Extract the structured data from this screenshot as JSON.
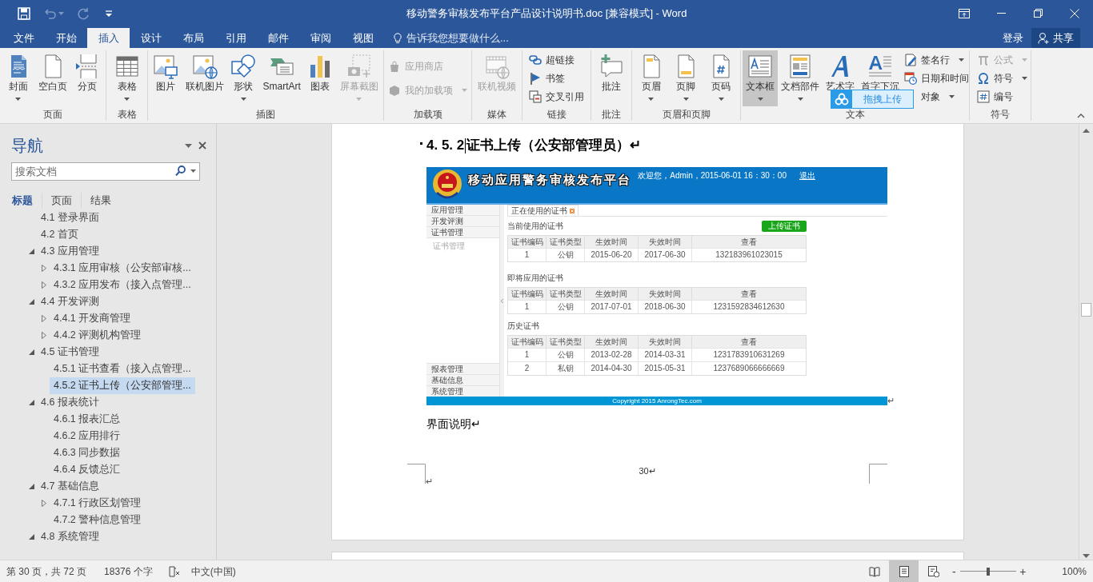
{
  "title_bar": {
    "quick_access": [
      {
        "kind": "save",
        "disabled": false
      },
      {
        "kind": "undo",
        "disabled": true
      },
      {
        "kind": "redo",
        "disabled": true
      },
      {
        "kind": "customize",
        "disabled": false
      }
    ],
    "title": "移动警务审核发布平台产品设计说明书.doc [兼容模式] - Word"
  },
  "ribbon_tabs": [
    {
      "label": "文件",
      "selected": false
    },
    {
      "label": "开始",
      "selected": false
    },
    {
      "label": "插入",
      "selected": true
    },
    {
      "label": "设计",
      "selected": false
    },
    {
      "label": "布局",
      "selected": false
    },
    {
      "label": "引用",
      "selected": false
    },
    {
      "label": "邮件",
      "selected": false
    },
    {
      "label": "审阅",
      "selected": false
    },
    {
      "label": "视图",
      "selected": false
    }
  ],
  "tell_me": "告诉我您想要做什么...",
  "account": {
    "sign_in": "登录",
    "share": "共享"
  },
  "ribbon_groups": [
    {
      "label": "页面",
      "items": [
        {
          "label": "封面",
          "kind": "large",
          "dropdown": true,
          "disabled": false,
          "highlighted": false
        },
        {
          "label": "空白页",
          "kind": "large",
          "dropdown": false,
          "disabled": false,
          "highlighted": false
        },
        {
          "label": "分页",
          "kind": "large",
          "dropdown": false,
          "disabled": false,
          "highlighted": false
        }
      ]
    },
    {
      "label": "表格",
      "items": [
        {
          "label": "表格",
          "kind": "large",
          "dropdown": true,
          "disabled": false,
          "highlighted": false
        }
      ]
    },
    {
      "label": "插图",
      "items": [
        {
          "label": "图片",
          "kind": "large",
          "dropdown": false,
          "disabled": false,
          "highlighted": false
        },
        {
          "label": "联机图片",
          "kind": "large",
          "dropdown": false,
          "disabled": false,
          "highlighted": false
        },
        {
          "label": "形状",
          "kind": "large",
          "dropdown": true,
          "disabled": false,
          "highlighted": false
        },
        {
          "label": "SmartArt",
          "kind": "large",
          "dropdown": false,
          "disabled": false,
          "highlighted": false
        },
        {
          "label": "图表",
          "kind": "large",
          "dropdown": false,
          "disabled": false,
          "highlighted": false
        },
        {
          "label": "屏幕截图",
          "kind": "large",
          "dropdown": true,
          "disabled": true,
          "highlighted": false
        }
      ]
    },
    {
      "label": "加载项",
      "items": [
        {
          "label": "应用商店",
          "kind": "small",
          "dropdown": false,
          "disabled": true,
          "highlighted": false
        },
        {
          "label": "我的加载项",
          "kind": "small",
          "dropdown": true,
          "disabled": true,
          "highlighted": false
        }
      ]
    },
    {
      "label": "媒体",
      "items": [
        {
          "label": "联机视频",
          "kind": "large",
          "dropdown": false,
          "disabled": true,
          "highlighted": false
        }
      ]
    },
    {
      "label": "链接",
      "items": [
        {
          "label": "超链接",
          "kind": "small",
          "dropdown": false,
          "disabled": false,
          "highlighted": false
        },
        {
          "label": "书签",
          "kind": "small",
          "dropdown": false,
          "disabled": false,
          "highlighted": false
        },
        {
          "label": "交叉引用",
          "kind": "small",
          "dropdown": false,
          "disabled": false,
          "highlighted": false
        }
      ]
    },
    {
      "label": "批注",
      "items": [
        {
          "label": "批注",
          "kind": "large",
          "dropdown": false,
          "disabled": false,
          "highlighted": false
        }
      ]
    },
    {
      "label": "页眉和页脚",
      "items": [
        {
          "label": "页眉",
          "kind": "large",
          "dropdown": true,
          "disabled": false,
          "highlighted": false
        },
        {
          "label": "页脚",
          "kind": "large",
          "dropdown": true,
          "disabled": false,
          "highlighted": false
        },
        {
          "label": "页码",
          "kind": "large",
          "dropdown": true,
          "disabled": false,
          "highlighted": false
        }
      ]
    },
    {
      "label": "文本",
      "items": [
        {
          "label": "文本框",
          "kind": "large",
          "dropdown": true,
          "disabled": false,
          "highlighted": true
        },
        {
          "label": "文档部件",
          "kind": "large",
          "dropdown": true,
          "disabled": false,
          "highlighted": false
        },
        {
          "label": "艺术字",
          "kind": "large",
          "disabled": false,
          "highlighted": false
        },
        {
          "label": "首字下沉",
          "kind": "large",
          "disabled": false,
          "highlighted": false
        },
        {
          "label": "签名行",
          "kind": "small",
          "dropdown": true,
          "disabled": false,
          "highlighted": false
        },
        {
          "label": "日期和时间",
          "kind": "small",
          "dropdown": false,
          "disabled": false,
          "highlighted": false
        },
        {
          "label": "对象",
          "kind": "small",
          "dropdown": true,
          "disabled": false,
          "highlighted": false
        }
      ]
    },
    {
      "label": "符号",
      "items": [
        {
          "label": "公式",
          "kind": "small",
          "dropdown": true,
          "disabled": true,
          "highlighted": false
        },
        {
          "label": "符号",
          "kind": "small",
          "dropdown": true,
          "disabled": false,
          "highlighted": false
        },
        {
          "label": "编号",
          "kind": "small",
          "dropdown": false,
          "disabled": false,
          "highlighted": false
        }
      ]
    }
  ],
  "upload_overlay": {
    "label": "拖拽上传"
  },
  "navigation": {
    "title": "导航",
    "search": {
      "placeholder": "搜索文档"
    },
    "tabs": [
      {
        "label": "标题",
        "selected": true
      },
      {
        "label": "页面",
        "selected": false
      },
      {
        "label": "结果",
        "selected": false
      }
    ],
    "tree": [
      {
        "label": "4.1 登录界面",
        "selected": false
      },
      {
        "label": "4.2 首页",
        "selected": false
      },
      {
        "label": "4.3 应用管理",
        "selected": false,
        "expanded": true,
        "children": [
          {
            "label": "4.3.1 应用审核（公安部审核...",
            "selected": false,
            "expanded": false
          },
          {
            "label": "4.3.2 应用发布（接入点管理...",
            "selected": false,
            "expanded": false
          }
        ]
      },
      {
        "label": "4.4 开发评测",
        "selected": false,
        "expanded": true,
        "children": [
          {
            "label": "4.4.1 开发商管理",
            "selected": false,
            "expanded": false
          },
          {
            "label": "4.4.2 评测机构管理",
            "selected": false,
            "expanded": false
          }
        ]
      },
      {
        "label": "4.5 证书管理",
        "selected": false,
        "expanded": true,
        "children": [
          {
            "label": "4.5.1 证书查看（接入点管理...",
            "selected": false
          },
          {
            "label": "4.5.2 证书上传（公安部管理...",
            "selected": true
          }
        ]
      },
      {
        "label": "4.6 报表统计",
        "selected": false,
        "expanded": true,
        "children": [
          {
            "label": "4.6.1 报表汇总",
            "selected": false
          },
          {
            "label": "4.6.2 应用排行",
            "selected": false
          },
          {
            "label": "4.6.3 同步数据",
            "selected": false
          },
          {
            "label": "4.6.4 反馈总汇",
            "selected": false
          }
        ]
      },
      {
        "label": "4.7 基础信息",
        "selected": false,
        "expanded": true,
        "children": [
          {
            "label": "4.7.1 行政区划管理",
            "selected": false,
            "expanded": false
          },
          {
            "label": "4.7.2 警种信息管理",
            "selected": false
          }
        ]
      },
      {
        "label": "4.8 系统管理",
        "selected": false,
        "expanded": true
      }
    ]
  },
  "document": {
    "heading": {
      "number": "4. 5. 2",
      "text": "证书上传（公安部管理员）↵"
    },
    "figure": {
      "title": "移动应用警务审核发布平台",
      "welcome": "欢迎您，Admin，2015-06-01 16：30：00",
      "logout": "退出",
      "menu": [
        {
          "label": "应用管理"
        },
        {
          "label": "开发评测"
        },
        {
          "label": "证书管理",
          "children": [
            {
              "label": "证书管理"
            }
          ]
        }
      ],
      "menu_bottom": [
        {
          "label": "报表管理"
        },
        {
          "label": "基础信息"
        },
        {
          "label": "系统管理"
        }
      ],
      "tab": "正在使用的证书",
      "sections": [
        {
          "title": "当前使用的证书",
          "action": "上传证书",
          "columns": [
            "证书编码",
            "证书类型",
            "生效时间",
            "失效时间",
            "查看"
          ],
          "rows": [
            [
              "1",
              "公钥",
              "2015-06-20",
              "2017-06-30",
              "132183961023015"
            ]
          ]
        },
        {
          "title": "即将应用的证书",
          "columns": [
            "证书编码",
            "证书类型",
            "生效时间",
            "失效时间",
            "查看"
          ],
          "rows": [
            [
              "1",
              "公钥",
              "2017-07-01",
              "2018-06-30",
              "1231592834612630"
            ]
          ]
        },
        {
          "title": "历史证书",
          "columns": [
            "证书编码",
            "证书类型",
            "生效时间",
            "失效时间",
            "查看"
          ],
          "rows": [
            [
              "1",
              "公钥",
              "2013-02-28",
              "2014-03-31",
              "1231783910631269"
            ],
            [
              "2",
              "私钥",
              "2014-04-30",
              "2015-05-31",
              "1237689066666669"
            ]
          ]
        }
      ],
      "footer": "Copyright 2015 AnrongTec.com",
      "mark": "↵"
    },
    "caption": "界面说明↵",
    "footer": {
      "page_number": "30↵",
      "mark": "↵"
    }
  },
  "status_bar": {
    "page": "第 30 页，共 72 页",
    "words": "18376 个字",
    "language": "中文(中国)",
    "views": [
      {
        "kind": "read",
        "selected": false
      },
      {
        "kind": "print",
        "selected": true
      },
      {
        "kind": "web",
        "selected": false
      }
    ],
    "zoom": {
      "out": "-",
      "in": "+",
      "level": 0.5,
      "reading": "100%"
    }
  }
}
